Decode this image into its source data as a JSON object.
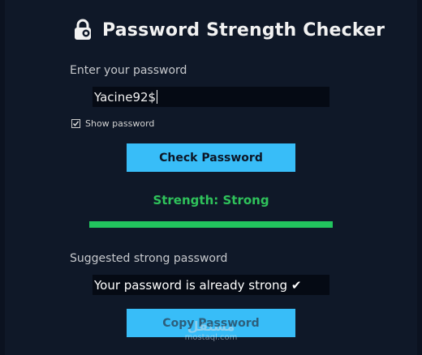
{
  "header": {
    "icon": "lock-key-icon",
    "title": "Password Strength Checker"
  },
  "password": {
    "label": "Enter your password",
    "value": "Yacine92$"
  },
  "show_password": {
    "label": "Show password",
    "checked": true
  },
  "check_button": {
    "label": "Check Password"
  },
  "strength": {
    "text": "Strength: Strong",
    "level_fraction": 1.0,
    "color": "#22c55e"
  },
  "suggestion": {
    "label": "Suggested strong password",
    "value": "Your password is already strong ✔"
  },
  "copy_button": {
    "label": "Copy Password"
  },
  "watermark": {
    "logo": "مستقل",
    "text": "mostaql.com"
  },
  "colors": {
    "background": "#0f1828",
    "accent": "#38bdf8",
    "success": "#22c55e"
  }
}
